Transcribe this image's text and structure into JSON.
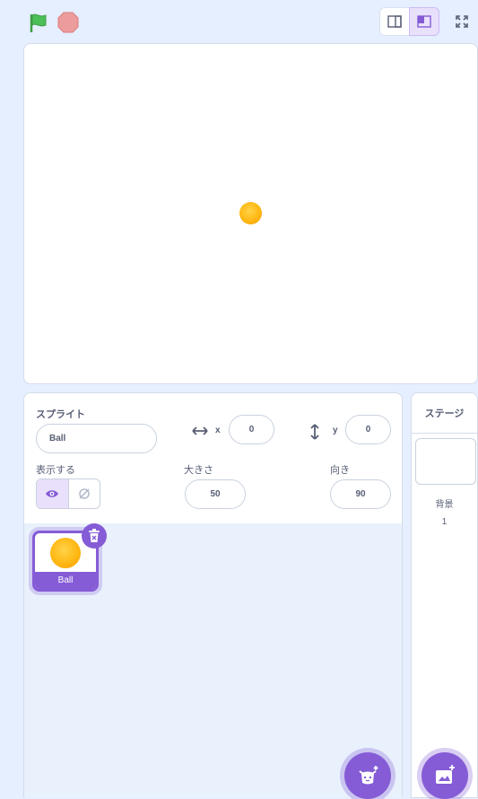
{
  "sprite_info": {
    "sprite_label": "スプライト",
    "sprite_name": "Ball",
    "x_label": "x",
    "x_value": "0",
    "y_label": "y",
    "y_value": "0",
    "show_label": "表示する",
    "size_label": "大きさ",
    "size_value": "50",
    "direction_label": "向き",
    "direction_value": "90"
  },
  "sprites": [
    {
      "name": "Ball",
      "selected": true
    }
  ],
  "stage_panel": {
    "title": "ステージ",
    "backdrops_label": "背景",
    "backdrops_count": "1"
  },
  "icons": {
    "green_flag": "green-flag-icon",
    "stop": "stop-icon",
    "small_stage": "small-stage-icon",
    "normal_stage": "normal-stage-icon",
    "fullscreen": "fullscreen-icon",
    "arrow_lr": "arrow-left-right-icon",
    "arrow_ud": "arrow-up-down-icon",
    "eye": "eye-icon",
    "eye_off": "eye-off-icon",
    "trash": "trash-icon",
    "add_sprite": "choose-sprite-icon",
    "add_backdrop": "choose-backdrop-icon"
  },
  "colors": {
    "accent": "#855cd6",
    "flag": "#4cbf56",
    "stop": "#ec9c9c",
    "background": "#e5efff"
  }
}
